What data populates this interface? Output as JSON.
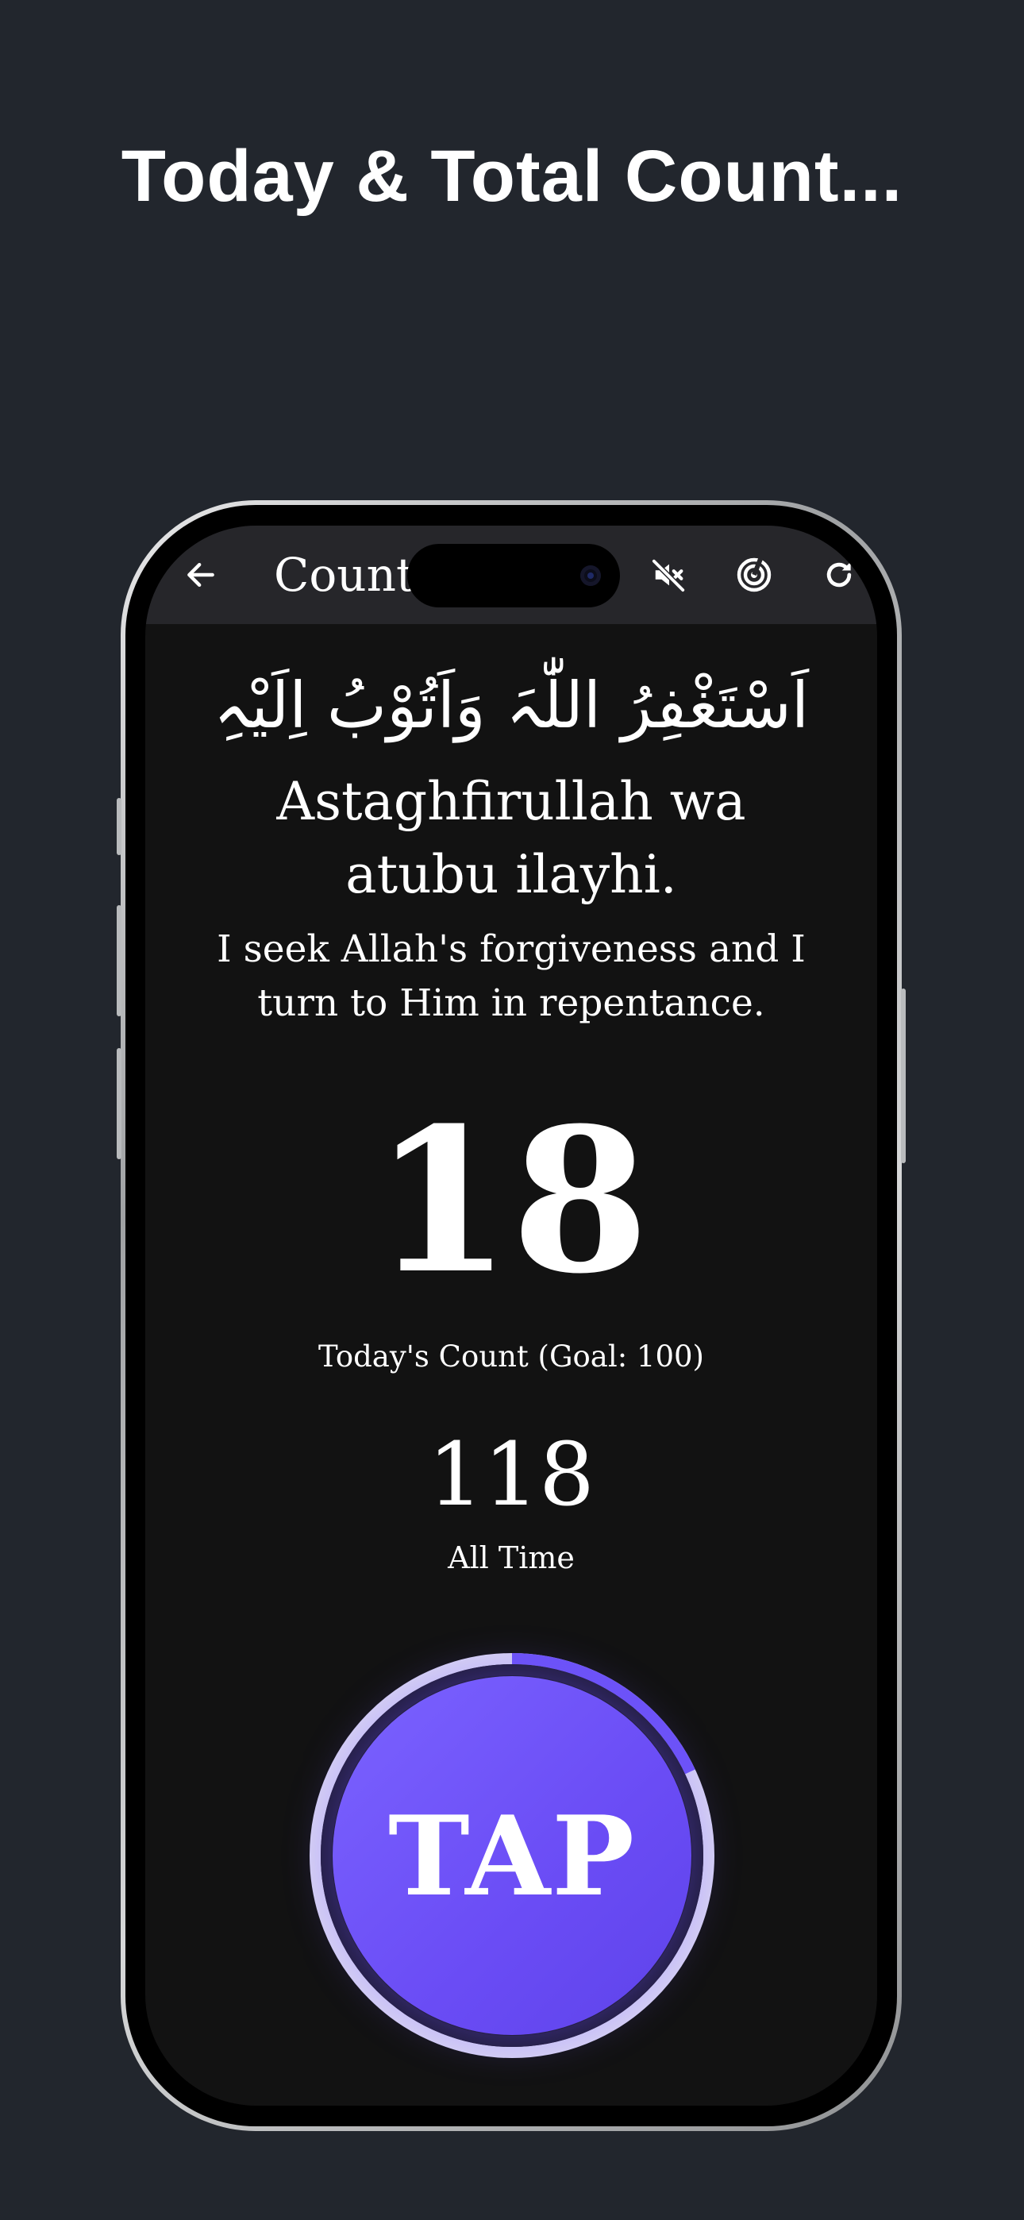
{
  "promo": {
    "title": "Today & Total Count..."
  },
  "app_bar": {
    "title": "Counter",
    "icons": [
      "back-arrow-icon",
      "mute-icon",
      "goal-target-icon",
      "refresh-icon"
    ]
  },
  "dhikr": {
    "arabic": "اَسْتَغْفِرُ اللّٰہَ وَاَتُوْبُ اِلَیْہِ",
    "transliteration": "Astaghfirullah wa atubu ilayhi.",
    "translation": "I seek Allah's forgiveness and I turn to Him in repentance."
  },
  "counter": {
    "today": "18",
    "today_label": "Today's Count (Goal: 100)",
    "total": "118",
    "total_label": "All Time",
    "goal_progress": 0.18
  },
  "tap_button": {
    "label": "TAP"
  },
  "colors": {
    "page_bg": "#22262d",
    "screen_bg": "#121212",
    "accent": "#6d53f8",
    "ring_track": "#d8d3f5"
  }
}
